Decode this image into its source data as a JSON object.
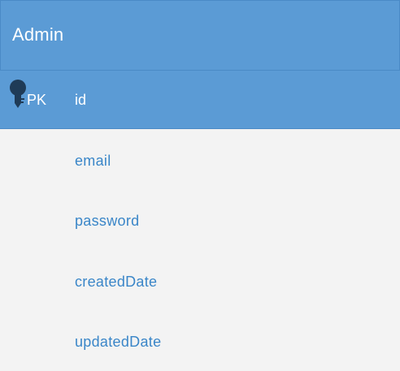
{
  "entity": {
    "title": "Admin",
    "primary_key": {
      "marker": "PK",
      "field": "id"
    },
    "fields": [
      "email",
      "password",
      "createdDate",
      "updatedDate"
    ]
  },
  "colors": {
    "header_bg": "#5b9bd5",
    "body_bg": "#f3f3f3",
    "field_text": "#3a86c8",
    "key_icon": "#1f3b57"
  },
  "icons": {
    "primary_key": "key-icon"
  }
}
